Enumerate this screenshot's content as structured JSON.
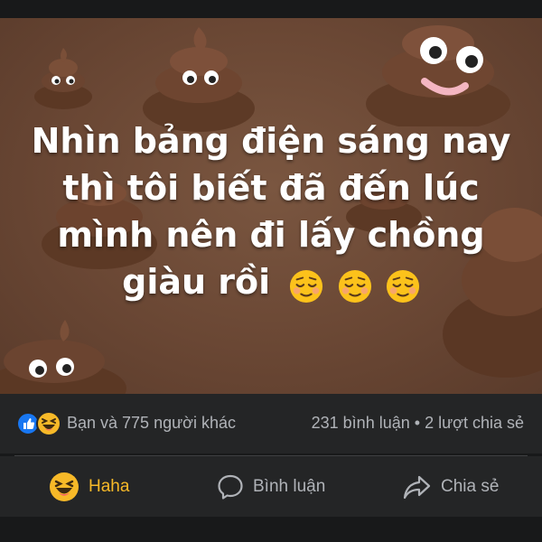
{
  "post": {
    "caption_lines": [
      "Nhìn bảng điện sáng nay",
      "thì tôi biết đã đến lúc",
      "mình nên đi lấy chồng",
      "giàu rồi"
    ],
    "caption_emojis": [
      "relieved-face-emoji",
      "relieved-face-emoji",
      "relieved-face-emoji"
    ]
  },
  "stats": {
    "reactions_text": "Bạn và 775 người khác",
    "comments_text": "231 bình luận",
    "separator": "•",
    "shares_text": "2 lượt chia sẻ",
    "reaction_icons": [
      "like-icon",
      "haha-icon"
    ]
  },
  "actions": {
    "haha_label": "Haha",
    "comment_label": "Bình luận",
    "share_label": "Chia sẻ"
  },
  "colors": {
    "background": "#18191a",
    "card": "#242526",
    "secondary_text": "#b0b3b8",
    "haha_accent": "#f7b928",
    "like_blue": "#1877f2",
    "image_brown": "#6a4734"
  }
}
